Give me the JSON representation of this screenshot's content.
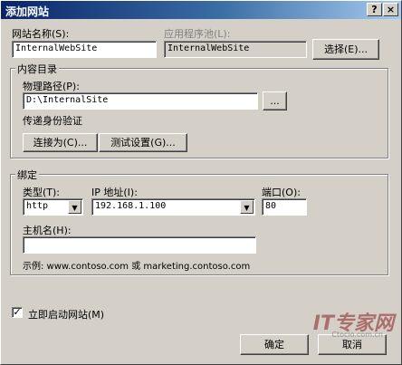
{
  "window": {
    "title": "添加网站",
    "help_glyph": "?",
    "close_glyph": "×"
  },
  "site": {
    "name_label": "网站名称(S):",
    "name_value": "InternalWebSite",
    "pool_label": "应用程序池(L):",
    "pool_value": "InternalWebSite",
    "select_button": "选择(E)..."
  },
  "content": {
    "group_label": "内容目录",
    "path_label": "物理路径(P):",
    "path_value": "D:\\InternalSite",
    "browse_button": "...",
    "auth_label": "传递身份验证",
    "connect_as_button": "连接为(C)...",
    "test_settings_button": "测试设置(G)..."
  },
  "binding": {
    "group_label": "绑定",
    "type_label": "类型(T):",
    "type_value": "http",
    "ip_label": "IP 地址(I):",
    "ip_value": "192.168.1.100",
    "port_label": "端口(O):",
    "port_value": "80",
    "host_label": "主机名(H):",
    "host_value": "",
    "example_text": "示例: www.contoso.com 或 marketing.contoso.com"
  },
  "start": {
    "checkbox_label": "立即启动网站(M)",
    "checked": true,
    "check_glyph": "✓"
  },
  "footer": {
    "ok_button": "确定",
    "cancel_button": "取消"
  },
  "watermark": {
    "main": "IT专家网",
    "sub": "Ctocio.com.cn"
  },
  "colors": {
    "titlebar_start": "#0a246a",
    "titlebar_end": "#a6caf0",
    "face": "#d4d0c8"
  }
}
